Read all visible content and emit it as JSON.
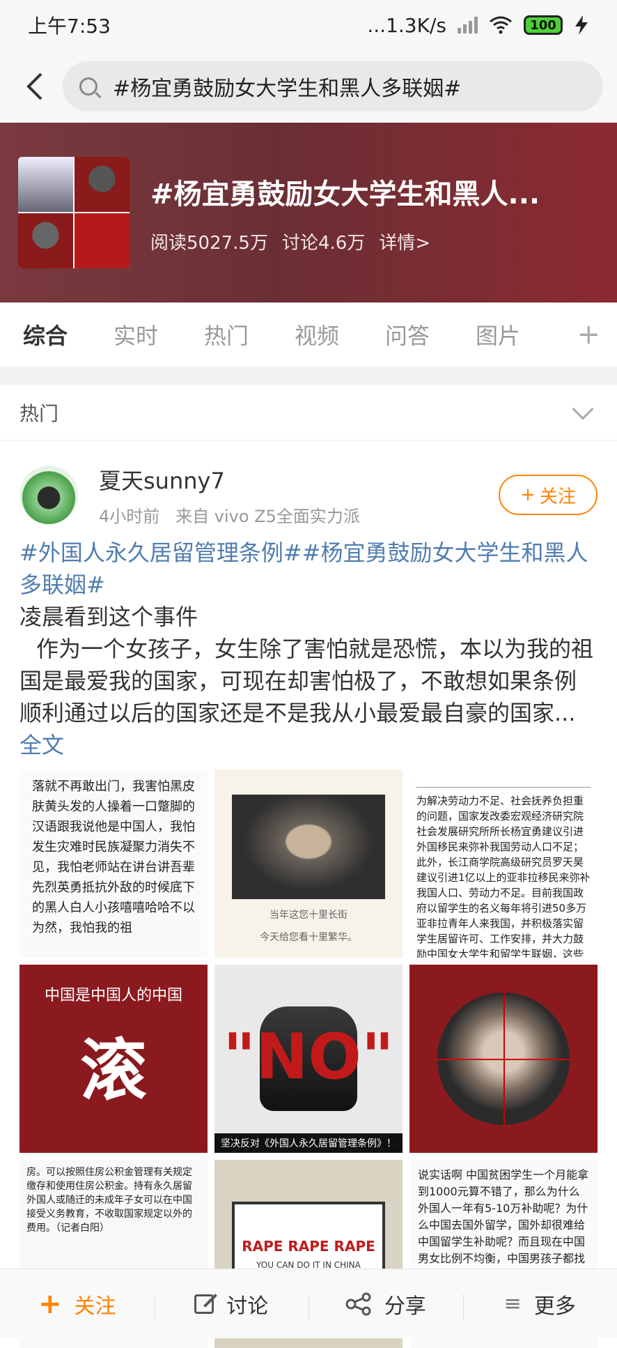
{
  "status_bar": {
    "time": "上午7:53",
    "network_speed": "...1.3K/s",
    "battery": "100",
    "icons": [
      "signal-icon",
      "wifi-icon",
      "battery-icon",
      "charging-icon"
    ]
  },
  "search": {
    "query": "#杨宜勇鼓励女大学生和黑人多联姻#"
  },
  "topic": {
    "title": "#杨宜勇鼓励女大学生和黑人...",
    "reads": "阅读5027.5万",
    "discussions": "讨论4.6万",
    "details": "详情>"
  },
  "tabs": [
    "综合",
    "实时",
    "热门",
    "视频",
    "问答",
    "图片"
  ],
  "section_label": "热门",
  "post": {
    "user": "夏天sunny7",
    "time_ago": "4小时前",
    "source": "来自 vivo Z5全面实力派",
    "follow_label": "关注",
    "hashtags": "#外国人永久居留管理条例##杨宜勇鼓励女大学生和黑人多联姻#",
    "line1": "凌晨看到这个事件",
    "body": "作为一个女孩子，女生除了害怕就是恐慌，本以为我的祖国是最爱我的国家，可现在却害怕极了，不敢想如果条例顺利通过以后的国家还是不是我从小最爱最自豪的国家...",
    "full_text": "全文"
  },
  "images": {
    "img1_text": "落就不再敢出门，我害怕黑皮肤黄头发的人操着一口蹩脚的汉语跟我说他是中国人，我怕发生灾难时民族凝聚力消失不见，我怕老师站在讲台讲吾辈先烈英勇抵抗外敌的时候底下的黑人白人小孩嘻嘻哈哈不以为然，我怕我的祖",
    "img2_caption1": "当年这您十里长街",
    "img2_caption2": "今天给您看十里繁华。",
    "img3_text": "为解决劳动力不足、社会抚养负担重的问题，国家发改委宏观经济研究院社会发展研究所所长杨宜勇建议引进外国移民来弥补我国劳动人口不足；此外，长江商学院高级研究员罗天昊建议引进1亿以上的亚非拉移民来弥补我国人口、劳动力不足。目前我国政府以留学生的名义每年将引进50多万亚非拉青年人来我国，并积极落实留学生居留许可、工作安排，并大力鼓励中国女大学生和留学生联姻，这些措施正是该建",
    "img4_line": "中国是中国人的中国",
    "img4_big": "滚",
    "img5_word": "\"NO\"",
    "img5_footer": "坚决反对《外国人永久居留管理条例》！",
    "img7_text": "房。可以按照住房公积金管理有关规定缴存和使用住房公积金。持有永久居留外国人或随迁的未成年子女可以在中国接受义务教育，不收取国家规定以外的费用。（记者白阳）",
    "img8_rape": "RAPE  RAPE  RAPE",
    "img8_sub": "YOU CAN DO IT IN CHINA",
    "img9_text": "说实话啊 中国贫困学生一个月能拿到1000元算不错了，那么为什么外国人一年有5-10万补助呢？为什么中国去国外留学，国外却很难给中国留学生补助呢？而且现在中国男女比例不均衡，中国男孩子都找不到对象，为什么还要中国女大学生和黑人联婚呢？还有我们中国人劳力工作，"
  },
  "bottom_bar": {
    "follow": "关注",
    "discuss": "讨论",
    "share": "分享",
    "more": "更多"
  },
  "colors": {
    "accent": "#ff8200",
    "hashtag": "#507daf",
    "banner": "#7a3a3f"
  }
}
